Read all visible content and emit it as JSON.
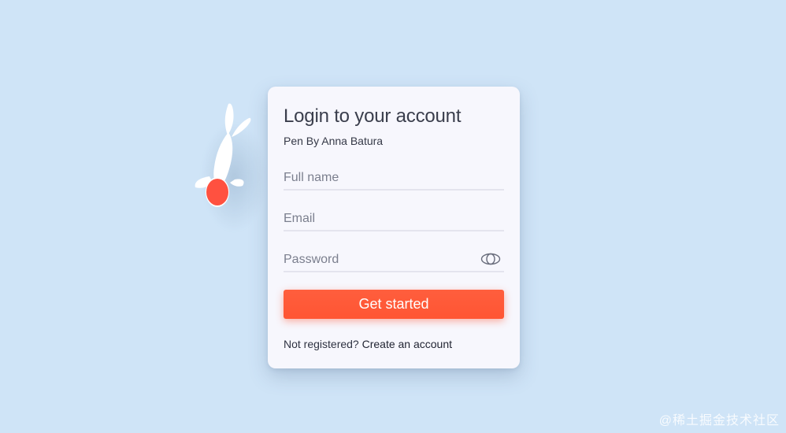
{
  "colors": {
    "background": "#cfe4f7",
    "card": "#f7f7fd",
    "accent": "#ff5533",
    "koi_spot": "#ff5140"
  },
  "decoration": {
    "icon": "koi-fish-icon"
  },
  "login": {
    "title": "Login to your account",
    "subtitle": "Pen By Anna Batura",
    "fields": {
      "full_name": {
        "placeholder": "Full name",
        "value": ""
      },
      "email": {
        "placeholder": "Email",
        "value": ""
      },
      "password": {
        "placeholder": "Password",
        "value": "",
        "toggle_icon": "eye-icon"
      }
    },
    "submit_label": "Get started",
    "register_prompt": "Not registered?",
    "register_link": "Create an account"
  },
  "watermark": "@稀土掘金技术社区"
}
